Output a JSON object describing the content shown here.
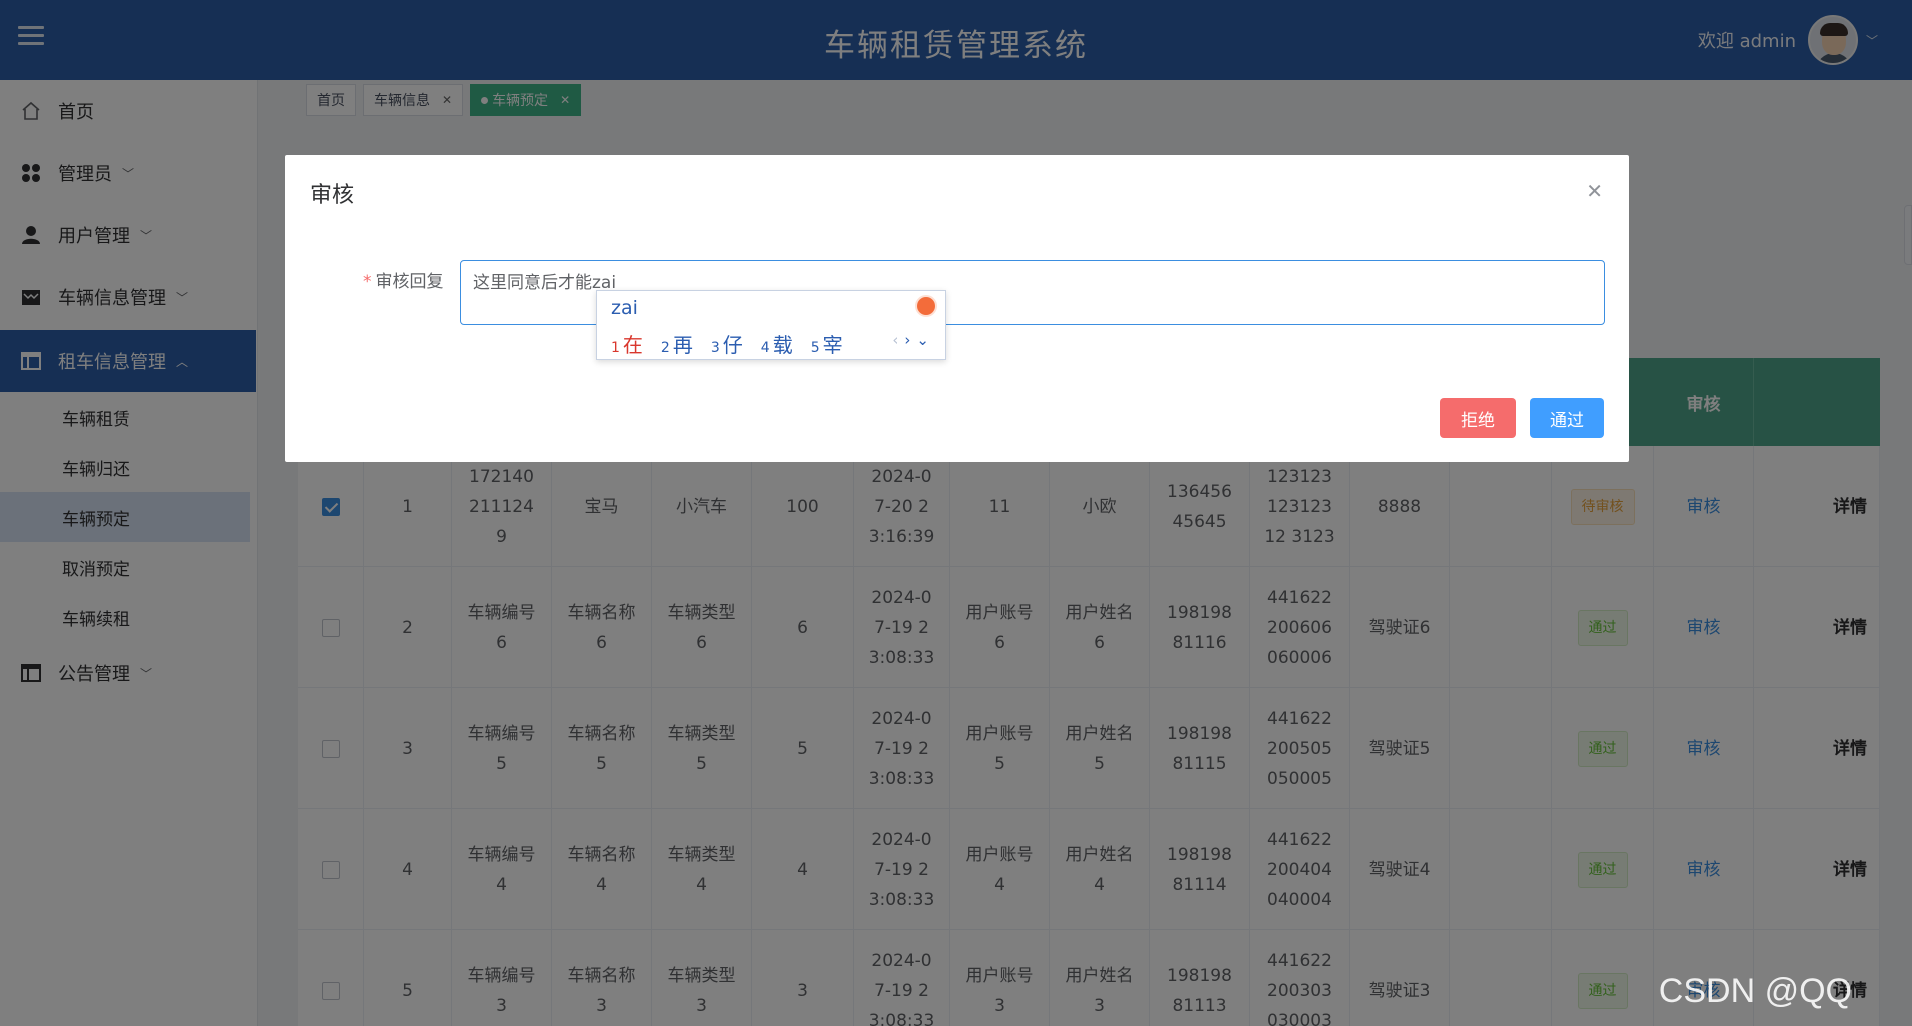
{
  "header": {
    "title": "车辆租赁管理系统",
    "welcome": "欢迎 admin"
  },
  "sidebar": {
    "items": [
      {
        "label": "首页",
        "icon": "home-icon"
      },
      {
        "label": "管理员",
        "icon": "grid-icon"
      },
      {
        "label": "用户管理",
        "icon": "user-icon"
      },
      {
        "label": "车辆信息管理",
        "icon": "shop-icon"
      },
      {
        "label": "租车信息管理",
        "icon": "table-icon"
      },
      {
        "label": "公告管理",
        "icon": "table-icon"
      }
    ],
    "subitems": [
      "车辆租赁",
      "车辆归还",
      "车辆预定",
      "取消预定",
      "车辆续租"
    ]
  },
  "tabs": [
    {
      "label": "首页"
    },
    {
      "label": "车辆信息"
    },
    {
      "label": "车辆预定"
    }
  ],
  "table": {
    "headers": {
      "audit": "审核"
    },
    "rows": [
      {
        "no": "1",
        "car_no": "1721402111249",
        "car_name": "宝马",
        "car_type": "小汽车",
        "price": "100",
        "time": "2024-07-20 23:16:39",
        "account": "11",
        "user_name": "小欧",
        "phone": "13645645645",
        "id_card": "12312312312312 3123",
        "license": "8888",
        "status": "待审核",
        "audit": "审核",
        "detail": "详情"
      },
      {
        "no": "2",
        "car_no": "车辆编号6",
        "car_name": "车辆名称6",
        "car_type": "车辆类型6",
        "price": "6",
        "time": "2024-07-19 23:08:33",
        "account": "用户账号6",
        "user_name": "用户姓名6",
        "phone": "19819881116",
        "id_card": "441622200606060006",
        "license": "驾驶证6",
        "status": "通过",
        "audit": "审核",
        "detail": "详情"
      },
      {
        "no": "3",
        "car_no": "车辆编号5",
        "car_name": "车辆名称5",
        "car_type": "车辆类型5",
        "price": "5",
        "time": "2024-07-19 23:08:33",
        "account": "用户账号5",
        "user_name": "用户姓名5",
        "phone": "19819881115",
        "id_card": "441622200505050005",
        "license": "驾驶证5",
        "status": "通过",
        "audit": "审核",
        "detail": "详情"
      },
      {
        "no": "4",
        "car_no": "车辆编号4",
        "car_name": "车辆名称4",
        "car_type": "车辆类型4",
        "price": "4",
        "time": "2024-07-19 23:08:33",
        "account": "用户账号4",
        "user_name": "用户姓名4",
        "phone": "19819881114",
        "id_card": "441622200404040004",
        "license": "驾驶证4",
        "status": "通过",
        "audit": "审核",
        "detail": "详情"
      },
      {
        "no": "5",
        "car_no": "车辆编号3",
        "car_name": "车辆名称3",
        "car_type": "车辆类型3",
        "price": "3",
        "time": "2024-07-19 23:08:33",
        "account": "用户账号3",
        "user_name": "用户姓名3",
        "phone": "19819881113",
        "id_card": "441622200303030003",
        "license": "驾驶证3",
        "status": "通过",
        "audit": "审核",
        "detail": "详情"
      }
    ]
  },
  "dialog": {
    "title": "审核",
    "label": "审核回复",
    "required_mark": "*",
    "reply_value": "这里同意后才能zai",
    "reject_label": "拒绝",
    "approve_label": "通过"
  },
  "ime": {
    "composition": "zai",
    "candidates": [
      {
        "n": "1",
        "ch": "在"
      },
      {
        "n": "2",
        "ch": "再"
      },
      {
        "n": "3",
        "ch": "仔"
      },
      {
        "n": "4",
        "ch": "载"
      },
      {
        "n": "5",
        "ch": "宰"
      }
    ]
  },
  "watermark": "CSDN @QQ",
  "colors": {
    "header": "#2c5fa8",
    "table_header": "#4ea58a",
    "active_tab": "#3eb489",
    "reject": "#f56c6c",
    "approve": "#409eff"
  }
}
